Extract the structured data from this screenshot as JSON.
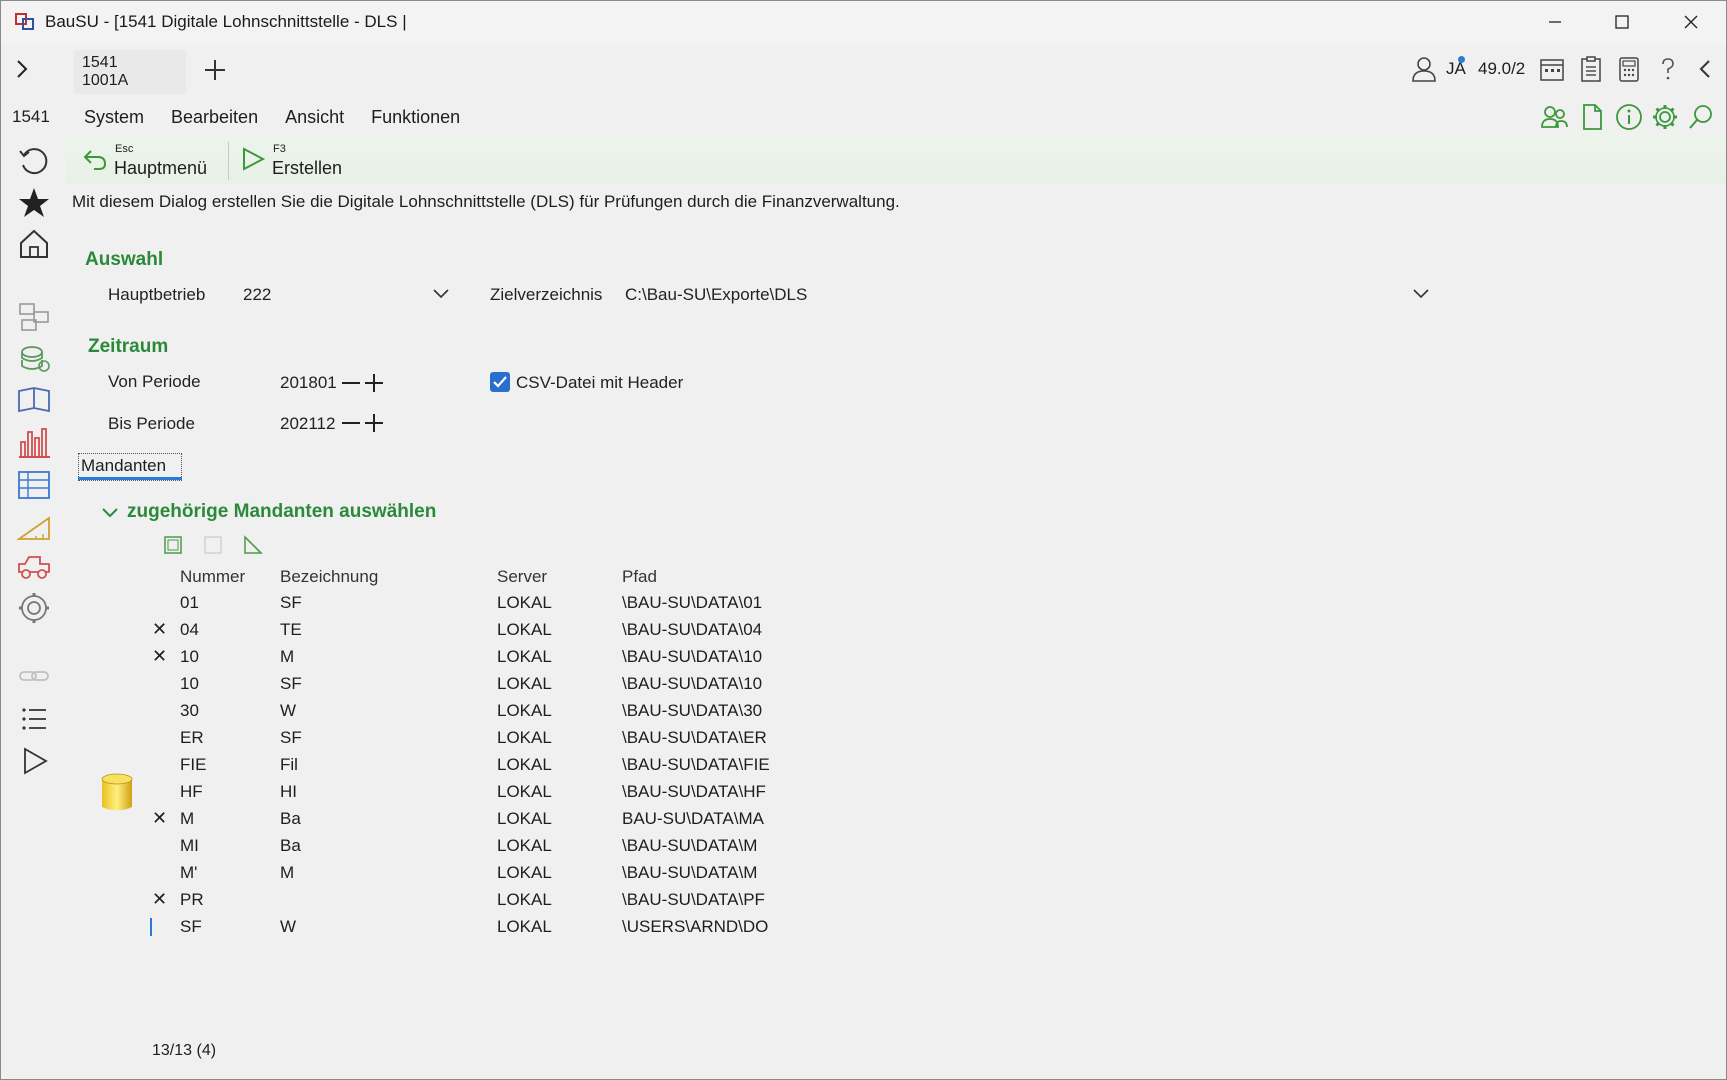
{
  "window": {
    "title": "BauSU - [1541 Digitale Lohnschnittstelle - DLS |"
  },
  "topbar": {
    "tab_line1": "1541",
    "tab_line2": "1001A",
    "user_label": "JA",
    "version_label": "49.0/2"
  },
  "module": {
    "number": "1541"
  },
  "menu": [
    {
      "label": "System"
    },
    {
      "label": "Bearbeiten"
    },
    {
      "label": "Ansicht"
    },
    {
      "label": "Funktionen"
    }
  ],
  "toolbar": {
    "back_key": "Esc",
    "back_label": "Hauptmenü",
    "create_key": "F3",
    "create_label": "Erstellen"
  },
  "info_text": "Mit diesem Dialog erstellen Sie die Digitale Lohnschnittstelle (DLS) für Prüfungen durch die Finanzverwaltung.",
  "auswahl": {
    "title": "Auswahl",
    "hauptbetrieb_label": "Hauptbetrieb",
    "hauptbetrieb_value": "222",
    "zielverzeichnis_label": "Zielverzeichnis",
    "zielverzeichnis_value": "C:\\Bau-SU\\Exporte\\DLS"
  },
  "zeitraum": {
    "title": "Zeitraum",
    "von_label": "Von Periode",
    "von_value": "201801",
    "bis_label": "Bis Periode",
    "bis_value": "202112",
    "csv_label": "CSV-Datei mit Header",
    "csv_checked": true
  },
  "tabs": {
    "mandanten": "Mandanten"
  },
  "mandanten": {
    "group_title": "zugehörige Mandanten auswählen",
    "columns": [
      "Nummer",
      "Bezeichnung",
      "Server",
      "Pfad"
    ],
    "rows": [
      {
        "selected": "",
        "nummer": "01",
        "bezeichnung": "SF",
        "server": "LOKAL",
        "pfad": "\\BAU-SU\\DATA\\01"
      },
      {
        "selected": "✕",
        "nummer": "04",
        "bezeichnung": "TE",
        "server": "LOKAL",
        "pfad": "\\BAU-SU\\DATA\\04"
      },
      {
        "selected": "✕",
        "nummer": "10",
        "bezeichnung": "M",
        "server": "LOKAL",
        "pfad": "\\BAU-SU\\DATA\\10"
      },
      {
        "selected": "",
        "nummer": "10",
        "bezeichnung": "SF",
        "server": "LOKAL",
        "pfad": "\\BAU-SU\\DATA\\10"
      },
      {
        "selected": "",
        "nummer": "30",
        "bezeichnung": "W",
        "server": "LOKAL",
        "pfad": "\\BAU-SU\\DATA\\30"
      },
      {
        "selected": "",
        "nummer": "ER",
        "bezeichnung": "SF",
        "server": "LOKAL",
        "pfad": "\\BAU-SU\\DATA\\ER"
      },
      {
        "selected": "",
        "nummer": "FIE",
        "bezeichnung": "Fil",
        "server": "LOKAL",
        "pfad": "\\BAU-SU\\DATA\\FIE"
      },
      {
        "selected": "",
        "nummer": "HF",
        "bezeichnung": "HI",
        "server": "LOKAL",
        "pfad": "\\BAU-SU\\DATA\\HF"
      },
      {
        "selected": "✕",
        "nummer": "M",
        "bezeichnung": "Ba",
        "server": "LOKAL",
        "pfad": "BAU-SU\\DATA\\MA"
      },
      {
        "selected": "",
        "nummer": "MI",
        "bezeichnung": "Ba",
        "server": "LOKAL",
        "pfad": "\\BAU-SU\\DATA\\M"
      },
      {
        "selected": "",
        "nummer": "M'",
        "bezeichnung": "M",
        "server": "LOKAL",
        "pfad": "\\BAU-SU\\DATA\\M"
      },
      {
        "selected": "✕",
        "nummer": "PR",
        "bezeichnung": "",
        "server": "LOKAL",
        "pfad": "\\BAU-SU\\DATA\\PF"
      },
      {
        "selected": "",
        "nummer": "SF",
        "bezeichnung": "W",
        "server": "LOKAL",
        "pfad": "\\USERS\\ARND\\DO"
      }
    ],
    "count": "13/13 (4)"
  }
}
